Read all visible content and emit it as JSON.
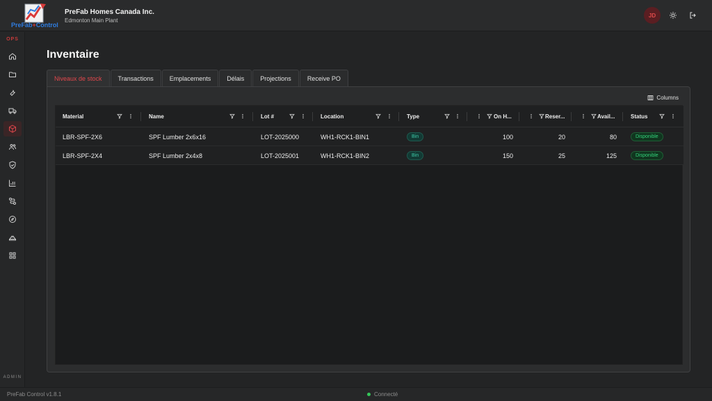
{
  "header": {
    "logo_text_a": "PreFab",
    "logo_text_b": "Control",
    "company": "PreFab Homes Canada Inc.",
    "plant": "Edmonton Main Plant",
    "avatar_initials": "JD"
  },
  "sidebar": {
    "section_top": "OPS",
    "section_bottom": "ADMIN",
    "items": [
      {
        "icon": "home-icon"
      },
      {
        "icon": "folder-icon"
      },
      {
        "icon": "wrench-icon"
      },
      {
        "icon": "truck-icon"
      },
      {
        "icon": "cube-icon",
        "active": true
      },
      {
        "icon": "users-icon"
      },
      {
        "icon": "shield-icon"
      },
      {
        "icon": "chart-icon"
      },
      {
        "icon": "route-icon"
      },
      {
        "icon": "compass-icon"
      },
      {
        "icon": "hardhat-icon"
      },
      {
        "icon": "apps-icon"
      }
    ]
  },
  "page": {
    "title": "Inventaire",
    "tabs": [
      "Niveaux de stock",
      "Transactions",
      "Emplacements",
      "Délais",
      "Projections",
      "Receive PO"
    ],
    "active_tab": 0,
    "columns_label": "Columns"
  },
  "grid": {
    "headers": {
      "material": "Material",
      "name": "Name",
      "lot": "Lot #",
      "location": "Location",
      "type": "Type",
      "on_hand": "On H...",
      "reserved": "Reser...",
      "available": "Avail...",
      "status": "Status"
    },
    "rows": [
      {
        "material": "LBR-SPF-2X6",
        "name": "SPF Lumber 2x6x16",
        "lot": "LOT-2025000",
        "location": "WH1-RCK1-BIN1",
        "type": "Bin",
        "on_hand": "100",
        "reserved": "20",
        "available": "80",
        "status": "Disponible"
      },
      {
        "material": "LBR-SPF-2X4",
        "name": "SPF Lumber 2x4x8",
        "lot": "LOT-2025001",
        "location": "WH1-RCK1-BIN2",
        "type": "Bin",
        "on_hand": "150",
        "reserved": "25",
        "available": "125",
        "status": "Disponible"
      }
    ]
  },
  "footer": {
    "version": "PreFab Control v1.8.1",
    "connection": "Connecté"
  },
  "colors": {
    "accent": "#e0474c",
    "status_ok": "#33d17a",
    "type_chip": "#3ec9a7"
  }
}
